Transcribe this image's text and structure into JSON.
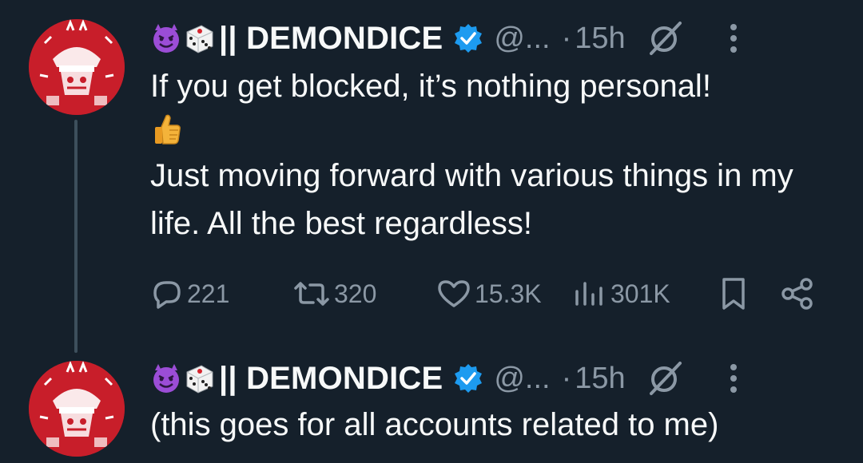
{
  "tweets": [
    {
      "display_name": "|| DEMONDICE",
      "handle": "@...",
      "dot": "·",
      "time": "15h",
      "text_line1": "If you get blocked, it’s nothing personal!",
      "text_line2": "Just moving forward with various things in my life. All the best regardless!",
      "icons": [
        "smiling-imp-emoji",
        "game-die-emoji",
        "verified-badge",
        "grok-icon",
        "more-icon",
        "thumbs-up-emoji"
      ]
    },
    {
      "display_name": "|| DEMONDICE",
      "handle": "@...",
      "dot": "·",
      "time": "15h",
      "text_line1": "(this goes for all accounts related to me)",
      "icons": [
        "smiling-imp-emoji",
        "game-die-emoji",
        "verified-badge",
        "grok-icon",
        "more-icon"
      ]
    }
  ],
  "actions": {
    "replies": "221",
    "reposts": "320",
    "likes": "15.3K",
    "views": "301K",
    "icons": [
      "reply-icon",
      "repost-icon",
      "like-icon",
      "views-icon",
      "bookmark-icon",
      "share-icon"
    ]
  },
  "colors": {
    "background": "#15202b",
    "text": "#f7f9f9",
    "secondary": "#8b98a5",
    "verified": "#1d9bf0",
    "avatar": "#c81e2a"
  }
}
